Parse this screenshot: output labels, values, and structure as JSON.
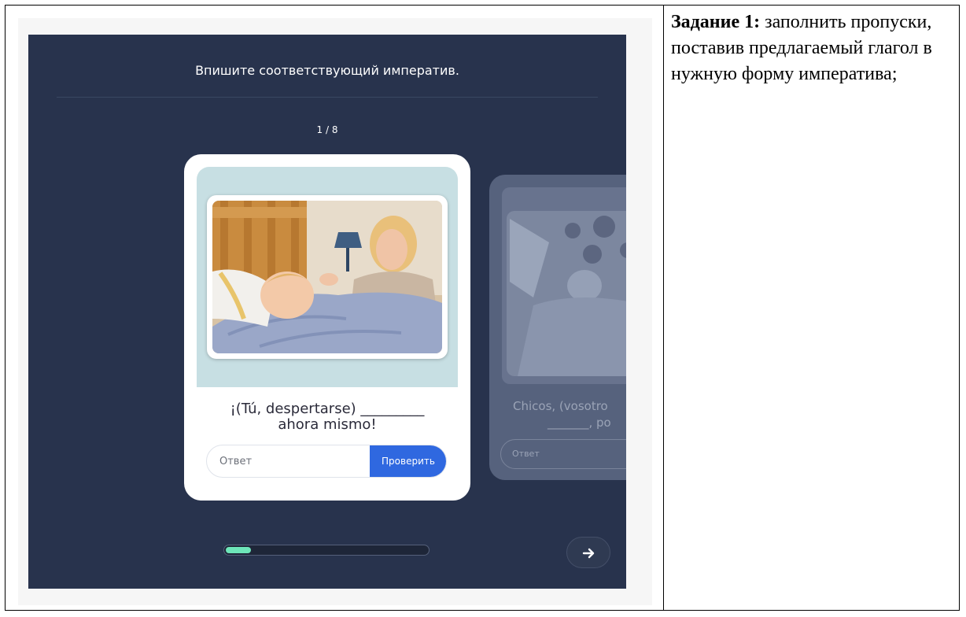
{
  "exercise": {
    "instruction": "Впишите соответствующий императив.",
    "counter": "1 / 8",
    "progress_fraction": 0.125,
    "current_card": {
      "question_line1": "¡(Tú, despertarse) _________",
      "question_line2": "ahora mismo!",
      "answer_placeholder": "Ответ",
      "check_label": "Проверить"
    },
    "next_card": {
      "question_line1": "Chicos, (vosotro",
      "question_line2": "_______, po",
      "answer_placeholder": "Ответ"
    },
    "icons": {
      "next": "arrow-right-icon"
    },
    "colors": {
      "background": "#28334d",
      "accent_button": "#2f68e0",
      "progress_fill": "#6ee6b9",
      "image_panel": "#c7dfe3"
    }
  },
  "task": {
    "heading": "Задание 1:",
    "description": " заполнить пропуски, поставив предлагаемый глагол в нужную форму императива;"
  }
}
